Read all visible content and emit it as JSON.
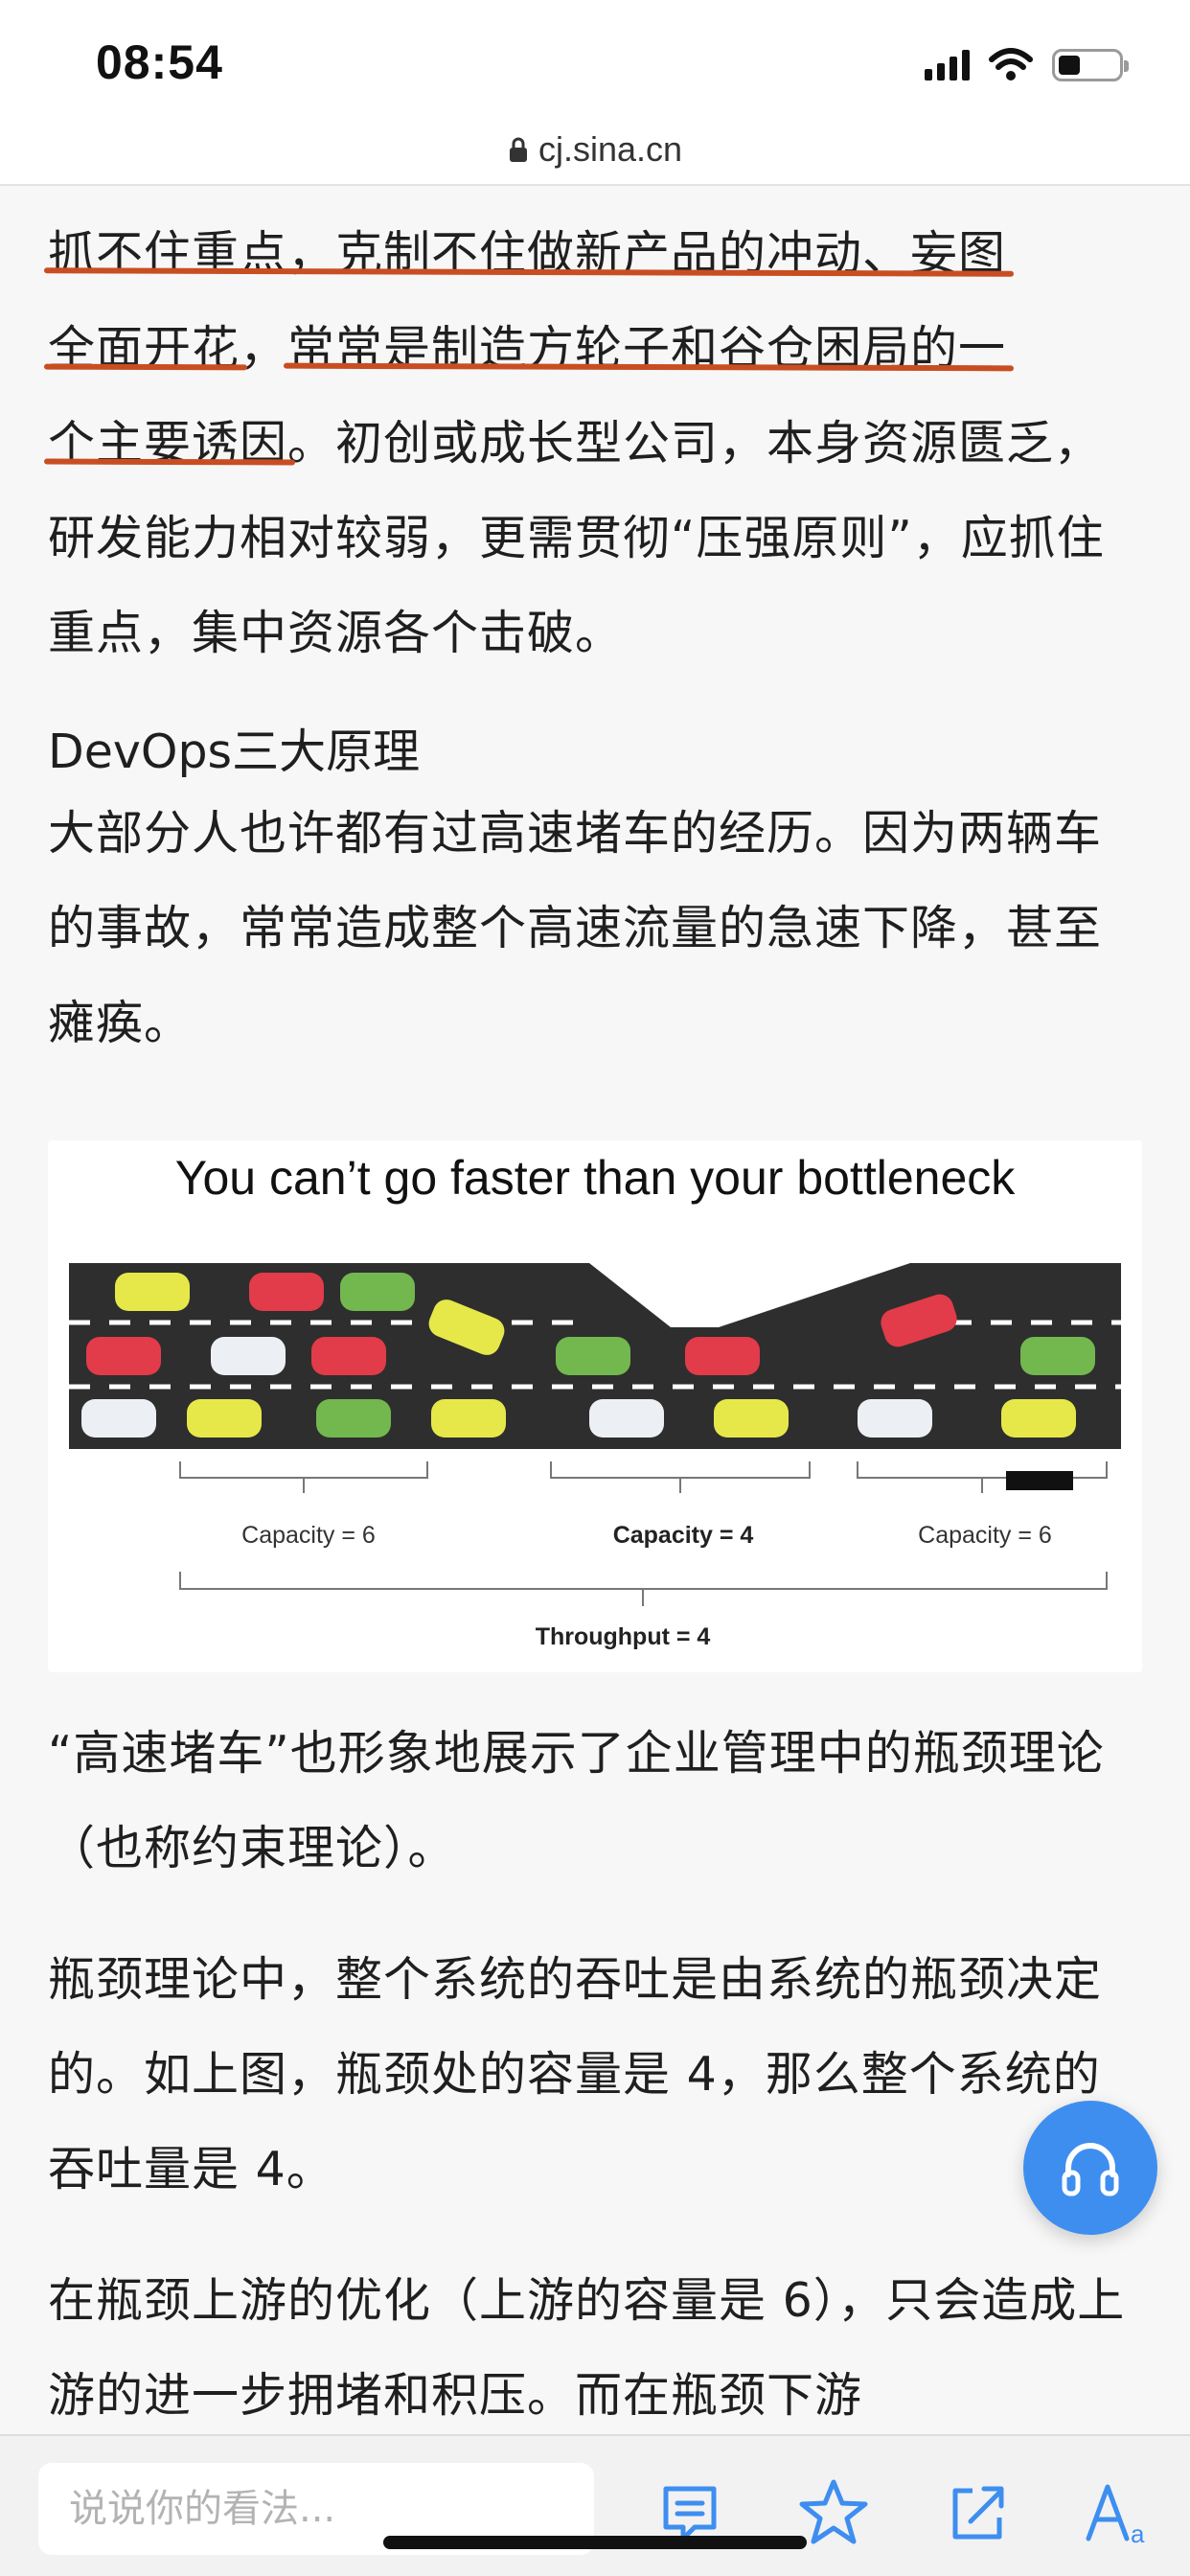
{
  "status_bar": {
    "time": "08:54"
  },
  "url_bar": {
    "host": "cj.sina.cn"
  },
  "article": {
    "paragraph1": [
      {
        "text": "抓不住重点，克制不住做新产品的冲动、妄图",
        "highlight": true
      },
      {
        "text": "全面开花",
        "highlight": true
      },
      {
        "text": "，",
        "highlight": false
      },
      {
        "text": "常常是制造方轮子和谷仓困局的一",
        "highlight": true
      },
      {
        "text": "个主要诱因",
        "highlight": true
      },
      {
        "text": "。初创或成长型公司，本身资源匮乏，研发能力相对较弱，更需贯彻“压强原则”，应抓住重点，集中资源各个击破。",
        "highlight": false
      }
    ],
    "heading": "DevOps三大原理",
    "paragraph2": "大部分人也许都有过高速堵车的经历。因为两辆车的事故，常常造成整个高速流量的急速下降，甚至瘫痪。",
    "figure": {
      "title": "You can’t go faster than your bottleneck",
      "capacity_left": "Capacity = 6",
      "capacity_mid": "Capacity = 4",
      "capacity_right": "Capacity = 6",
      "throughput": "Throughput = 4",
      "colors": {
        "road": "#2e2e2e",
        "red": "#e23b4a",
        "green": "#72b84e",
        "yellow": "#e6e84a",
        "white": "#eceff3"
      }
    },
    "paragraph3": "“高速堵车”也形象地展示了企业管理中的瓶颈理论（也称约束理论）。",
    "paragraph4": "瓶颈理论中，整个系统的吞吐是由系统的瓶颈决定的。如上图，瓶颈处的容量是 4，那么整个系统的吞吐量是 4。",
    "paragraph5": "在瓶颈上游的优化（上游的容量是 6），只会造成上游的进一步拥堵和积压。而在瓶颈下游"
  },
  "floating_button": {
    "icon": "headphones-icon",
    "color": "#3e8ef0"
  },
  "bottom_bar": {
    "comment_placeholder": "说说你的看法...",
    "icons": [
      "comment-icon",
      "star-icon",
      "share-icon",
      "font-size-icon"
    ],
    "accent": "#3e8ef0"
  }
}
